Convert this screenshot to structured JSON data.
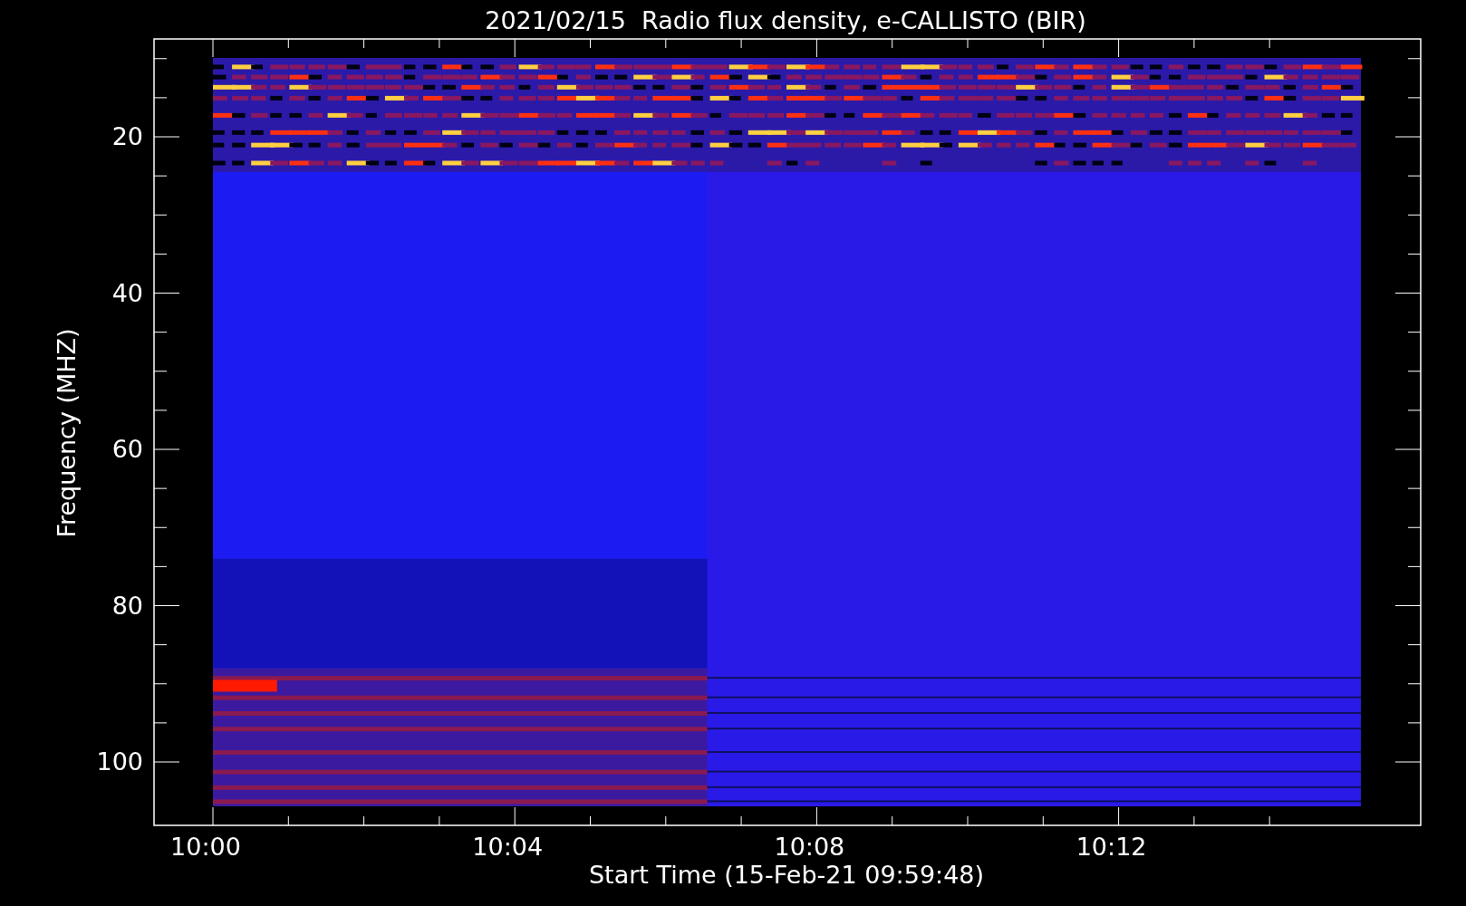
{
  "title": "2021/02/15  Radio flux density, e-CALLISTO (BIR)",
  "x_axis": {
    "label": "Start Time (15-Feb-21 09:59:48)",
    "ticks": [
      "10:00",
      "10:04",
      "10:08",
      "10:12"
    ]
  },
  "y_axis": {
    "label": "Frequency (MHZ)",
    "ticks": [
      "20",
      "40",
      "60",
      "80",
      "100"
    ]
  }
}
